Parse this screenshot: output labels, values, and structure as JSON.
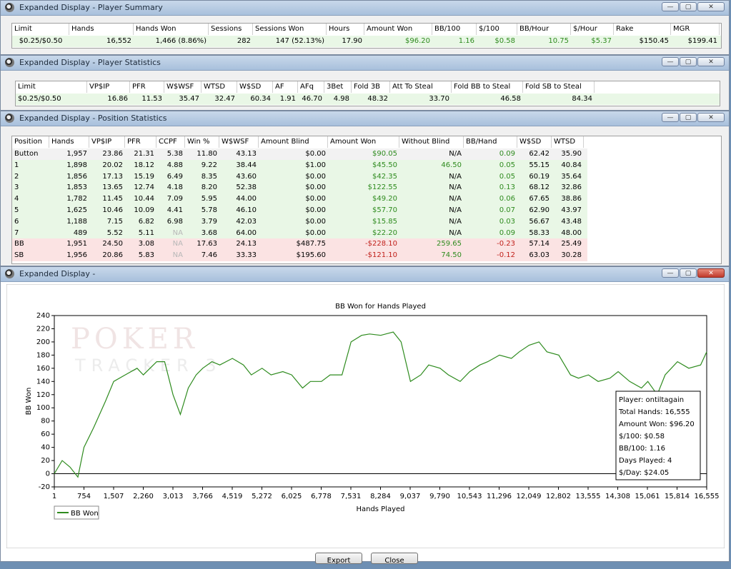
{
  "summary": {
    "title": "Expanded Display - Player Summary",
    "columns": [
      "Limit",
      "Hands",
      "Hands Won",
      "Sessions",
      "Sessions Won",
      "Hours",
      "Amount Won",
      "BB/100",
      "$/100",
      "BB/Hour",
      "$/Hour",
      "Rake",
      "MGR"
    ],
    "row": [
      "$0.25/$0.50",
      "16,552",
      "1,466 (8.86%)",
      "282",
      "147 (52.13%)",
      "17.90",
      "$96.20",
      "1.16",
      "$0.58",
      "10.75",
      "$5.37",
      "$150.45",
      "$199.41"
    ]
  },
  "stats": {
    "title": "Expanded Display - Player Statistics",
    "columns": [
      "Limit",
      "VP$IP",
      "PFR",
      "W$WSF",
      "WTSD",
      "W$SD",
      "AF",
      "AFq",
      "3Bet",
      "Fold 3B",
      "Att To Steal",
      "Fold BB to Steal",
      "Fold SB to Steal"
    ],
    "row": [
      "$0.25/$0.50",
      "16.86",
      "11.53",
      "35.47",
      "32.47",
      "60.34",
      "1.91",
      "46.70",
      "4.98",
      "48.32",
      "33.70",
      "46.58",
      "84.34"
    ]
  },
  "position": {
    "title": "Expanded Display - Position Statistics",
    "columns": [
      "Position",
      "Hands",
      "VP$IP",
      "PFR",
      "CCPF",
      "Win %",
      "W$WSF",
      "Amount Blind",
      "Amount Won",
      "Without Blind",
      "BB/Hand",
      "W$SD",
      "WTSD"
    ],
    "rows": [
      [
        "Button",
        "1,957",
        "23.86",
        "21.31",
        "5.38",
        "11.80",
        "43.13",
        "$0.00",
        "$90.05",
        "N/A",
        "0.09",
        "62.42",
        "35.90"
      ],
      [
        "1",
        "1,898",
        "20.02",
        "18.12",
        "4.88",
        "9.22",
        "38.44",
        "$1.00",
        "$45.50",
        "46.50",
        "0.05",
        "55.15",
        "40.84"
      ],
      [
        "2",
        "1,856",
        "17.13",
        "15.19",
        "6.49",
        "8.35",
        "43.60",
        "$0.00",
        "$42.35",
        "N/A",
        "0.05",
        "60.19",
        "35.64"
      ],
      [
        "3",
        "1,853",
        "13.65",
        "12.74",
        "4.18",
        "8.20",
        "52.38",
        "$0.00",
        "$122.55",
        "N/A",
        "0.13",
        "68.12",
        "32.86"
      ],
      [
        "4",
        "1,782",
        "11.45",
        "10.44",
        "7.09",
        "5.95",
        "44.00",
        "$0.00",
        "$49.20",
        "N/A",
        "0.06",
        "67.65",
        "38.86"
      ],
      [
        "5",
        "1,625",
        "10.46",
        "10.09",
        "4.41",
        "5.78",
        "46.10",
        "$0.00",
        "$57.70",
        "N/A",
        "0.07",
        "62.90",
        "43.97"
      ],
      [
        "6",
        "1,188",
        "7.15",
        "6.82",
        "6.98",
        "3.79",
        "42.03",
        "$0.00",
        "$15.85",
        "N/A",
        "0.03",
        "56.67",
        "43.48"
      ],
      [
        "7",
        "489",
        "5.52",
        "5.11",
        "NA",
        "3.68",
        "64.00",
        "$0.00",
        "$22.20",
        "N/A",
        "0.09",
        "58.33",
        "48.00"
      ],
      [
        "BB",
        "1,951",
        "24.50",
        "3.08",
        "NA",
        "17.63",
        "24.13",
        "$487.75",
        "-$228.10",
        "259.65",
        "-0.23",
        "57.14",
        "25.49"
      ],
      [
        "SB",
        "1,956",
        "20.86",
        "5.83",
        "NA",
        "7.46",
        "33.33",
        "$195.60",
        "-$121.10",
        "74.50",
        "-0.12",
        "63.03",
        "30.28"
      ]
    ]
  },
  "graph": {
    "title": "Expanded Display -",
    "export_label": "Export",
    "close_label": "Close",
    "info": {
      "lines": [
        "Player: ontiltagain",
        "Total Hands: 16,555",
        "Amount Won: $96.20",
        "$/100: $0.58",
        "BB/100: 1.16",
        "Days Played: 4",
        "$/Day: $24.05"
      ]
    }
  },
  "window_buttons": {
    "min": "—",
    "max": "▢",
    "close": "✕"
  },
  "chart_data": {
    "type": "line",
    "title": "BB Won for Hands Played",
    "xlabel": "Hands Played",
    "ylabel": "BB Won",
    "xlim": [
      1,
      16555
    ],
    "ylim": [
      -20,
      240
    ],
    "xticks": [
      "1",
      "754",
      "1,507",
      "2,260",
      "3,013",
      "3,766",
      "4,519",
      "5,272",
      "6,025",
      "6,778",
      "7,531",
      "8,284",
      "9,037",
      "9,790",
      "10,543",
      "11,296",
      "12,049",
      "12,802",
      "13,555",
      "14,308",
      "15,061",
      "15,814",
      "16,555"
    ],
    "yticks": [
      -20,
      0,
      20,
      40,
      60,
      80,
      100,
      120,
      140,
      160,
      180,
      200,
      220,
      240
    ],
    "grid": false,
    "legend": "bottom-left",
    "watermark": "POKER TRACKER 3",
    "series": [
      {
        "name": "BB Won",
        "color": "#2e8b1e",
        "x": [
          1,
          200,
          400,
          600,
          754,
          1000,
          1300,
          1507,
          1800,
          2100,
          2260,
          2600,
          2800,
          3013,
          3200,
          3400,
          3600,
          3766,
          4000,
          4200,
          4519,
          4800,
          5000,
          5272,
          5500,
          5800,
          6025,
          6300,
          6500,
          6778,
          7000,
          7300,
          7531,
          7800,
          8000,
          8284,
          8600,
          8800,
          9037,
          9300,
          9500,
          9790,
          10000,
          10300,
          10543,
          10800,
          11000,
          11296,
          11600,
          11800,
          12049,
          12300,
          12500,
          12802,
          13100,
          13300,
          13555,
          13800,
          14100,
          14308,
          14600,
          14900,
          15061,
          15300,
          15500,
          15814,
          16100,
          16400,
          16555
        ],
        "y": [
          0,
          20,
          10,
          -5,
          40,
          70,
          110,
          140,
          150,
          160,
          150,
          170,
          170,
          120,
          90,
          130,
          150,
          160,
          170,
          165,
          175,
          165,
          150,
          160,
          150,
          155,
          150,
          130,
          140,
          140,
          150,
          150,
          200,
          210,
          212,
          210,
          215,
          200,
          140,
          150,
          165,
          160,
          150,
          140,
          155,
          165,
          170,
          180,
          175,
          185,
          195,
          200,
          185,
          180,
          150,
          145,
          150,
          140,
          145,
          155,
          140,
          130,
          140,
          120,
          150,
          170,
          160,
          165,
          185
        ]
      }
    ]
  }
}
